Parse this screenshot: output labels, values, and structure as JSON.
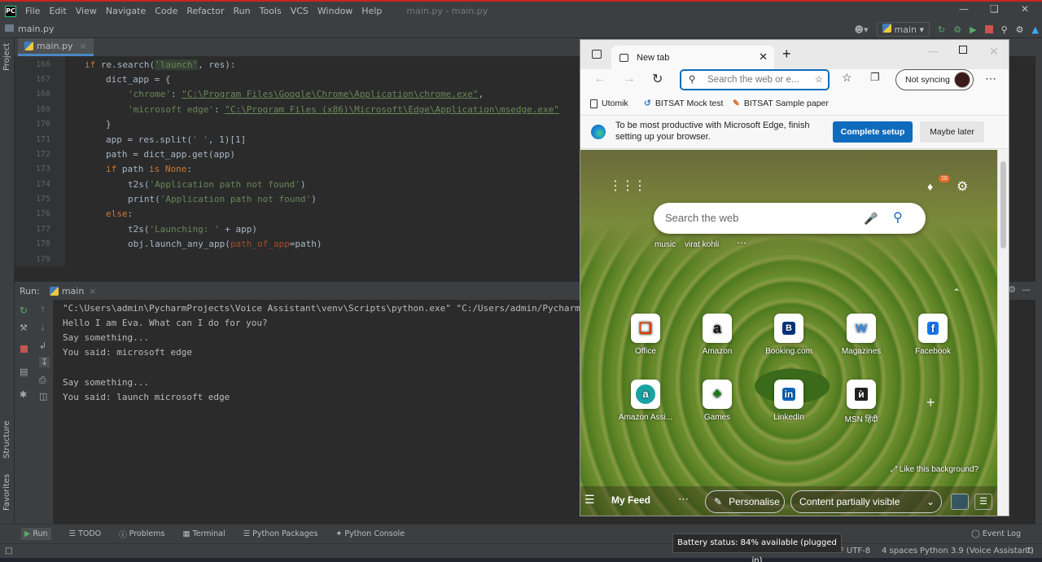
{
  "ide": {
    "menus": [
      "File",
      "Edit",
      "View",
      "Navigate",
      "Code",
      "Refactor",
      "Run",
      "Tools",
      "VCS",
      "Window",
      "Help"
    ],
    "window_title": "main.py - main.py",
    "project_name": "main.py",
    "branch": "main",
    "file_tab": "main.py",
    "left_tools": [
      "Project",
      "Structure",
      "Favorites"
    ]
  },
  "code": {
    "line_numbers": [
      "166",
      "167",
      "168",
      "169",
      "170",
      "171",
      "172",
      "173",
      "174",
      "175",
      "176",
      "177",
      "178",
      "179"
    ]
  },
  "run": {
    "label": "Run:",
    "tab": "main",
    "output": [
      "\"C:\\Users\\admin\\PycharmProjects\\Voice Assistant\\venv\\Scripts\\python.exe\" \"C:/Users/admin/Pycharm",
      "Hello I am Eva. What can I do for you?",
      "Say something...",
      "You said: microsoft edge",
      "",
      "Say something...",
      "You said: launch microsoft edge"
    ]
  },
  "bottom_tools": [
    "Run",
    "TODO",
    "Problems",
    "Terminal",
    "Python Packages",
    "Python Console"
  ],
  "event_log": "Event Log",
  "status": {
    "encoding": "F UTF-8",
    "indent": "4 spaces",
    "interpreter": "Python 3.9 (Voice Assistant)"
  },
  "battery_tooltip": "Battery status: 84% available (plugged in)",
  "edge": {
    "tab_title": "New tab",
    "address_placeholder": "Search the web or e...",
    "sync_label": "Not syncing",
    "favorites": [
      "Utomik",
      "BITSAT Mock test",
      "BITSAT Sample paper"
    ],
    "promo_text_1": "To be most productive with Microsoft Edge, finish",
    "promo_text_2": "setting up your browser.",
    "complete_setup": "Complete setup",
    "maybe_later": "Maybe later",
    "notification_count": "10",
    "search_placeholder": "Search the web",
    "quick_links": [
      "music",
      "virat kohli"
    ],
    "tiles": [
      {
        "label": "Office",
        "icon": "office-icon"
      },
      {
        "label": "Amazon",
        "icon": "amazon-icon"
      },
      {
        "label": "Booking.com",
        "icon": "booking-icon"
      },
      {
        "label": "Magazines",
        "icon": "magazines-icon"
      },
      {
        "label": "Facebook",
        "icon": "facebook-icon"
      },
      {
        "label": "Amazon Assi...",
        "icon": "amazon-assistant-icon"
      },
      {
        "label": "Games",
        "icon": "games-icon"
      },
      {
        "label": "LinkedIn",
        "icon": "linkedin-icon"
      },
      {
        "label": "MSN हिंदी",
        "icon": "msn-icon"
      }
    ],
    "like_background": "Like this background?",
    "my_feed": "My Feed",
    "personalise": "Personalise",
    "content_visibility": "Content partially visible"
  }
}
